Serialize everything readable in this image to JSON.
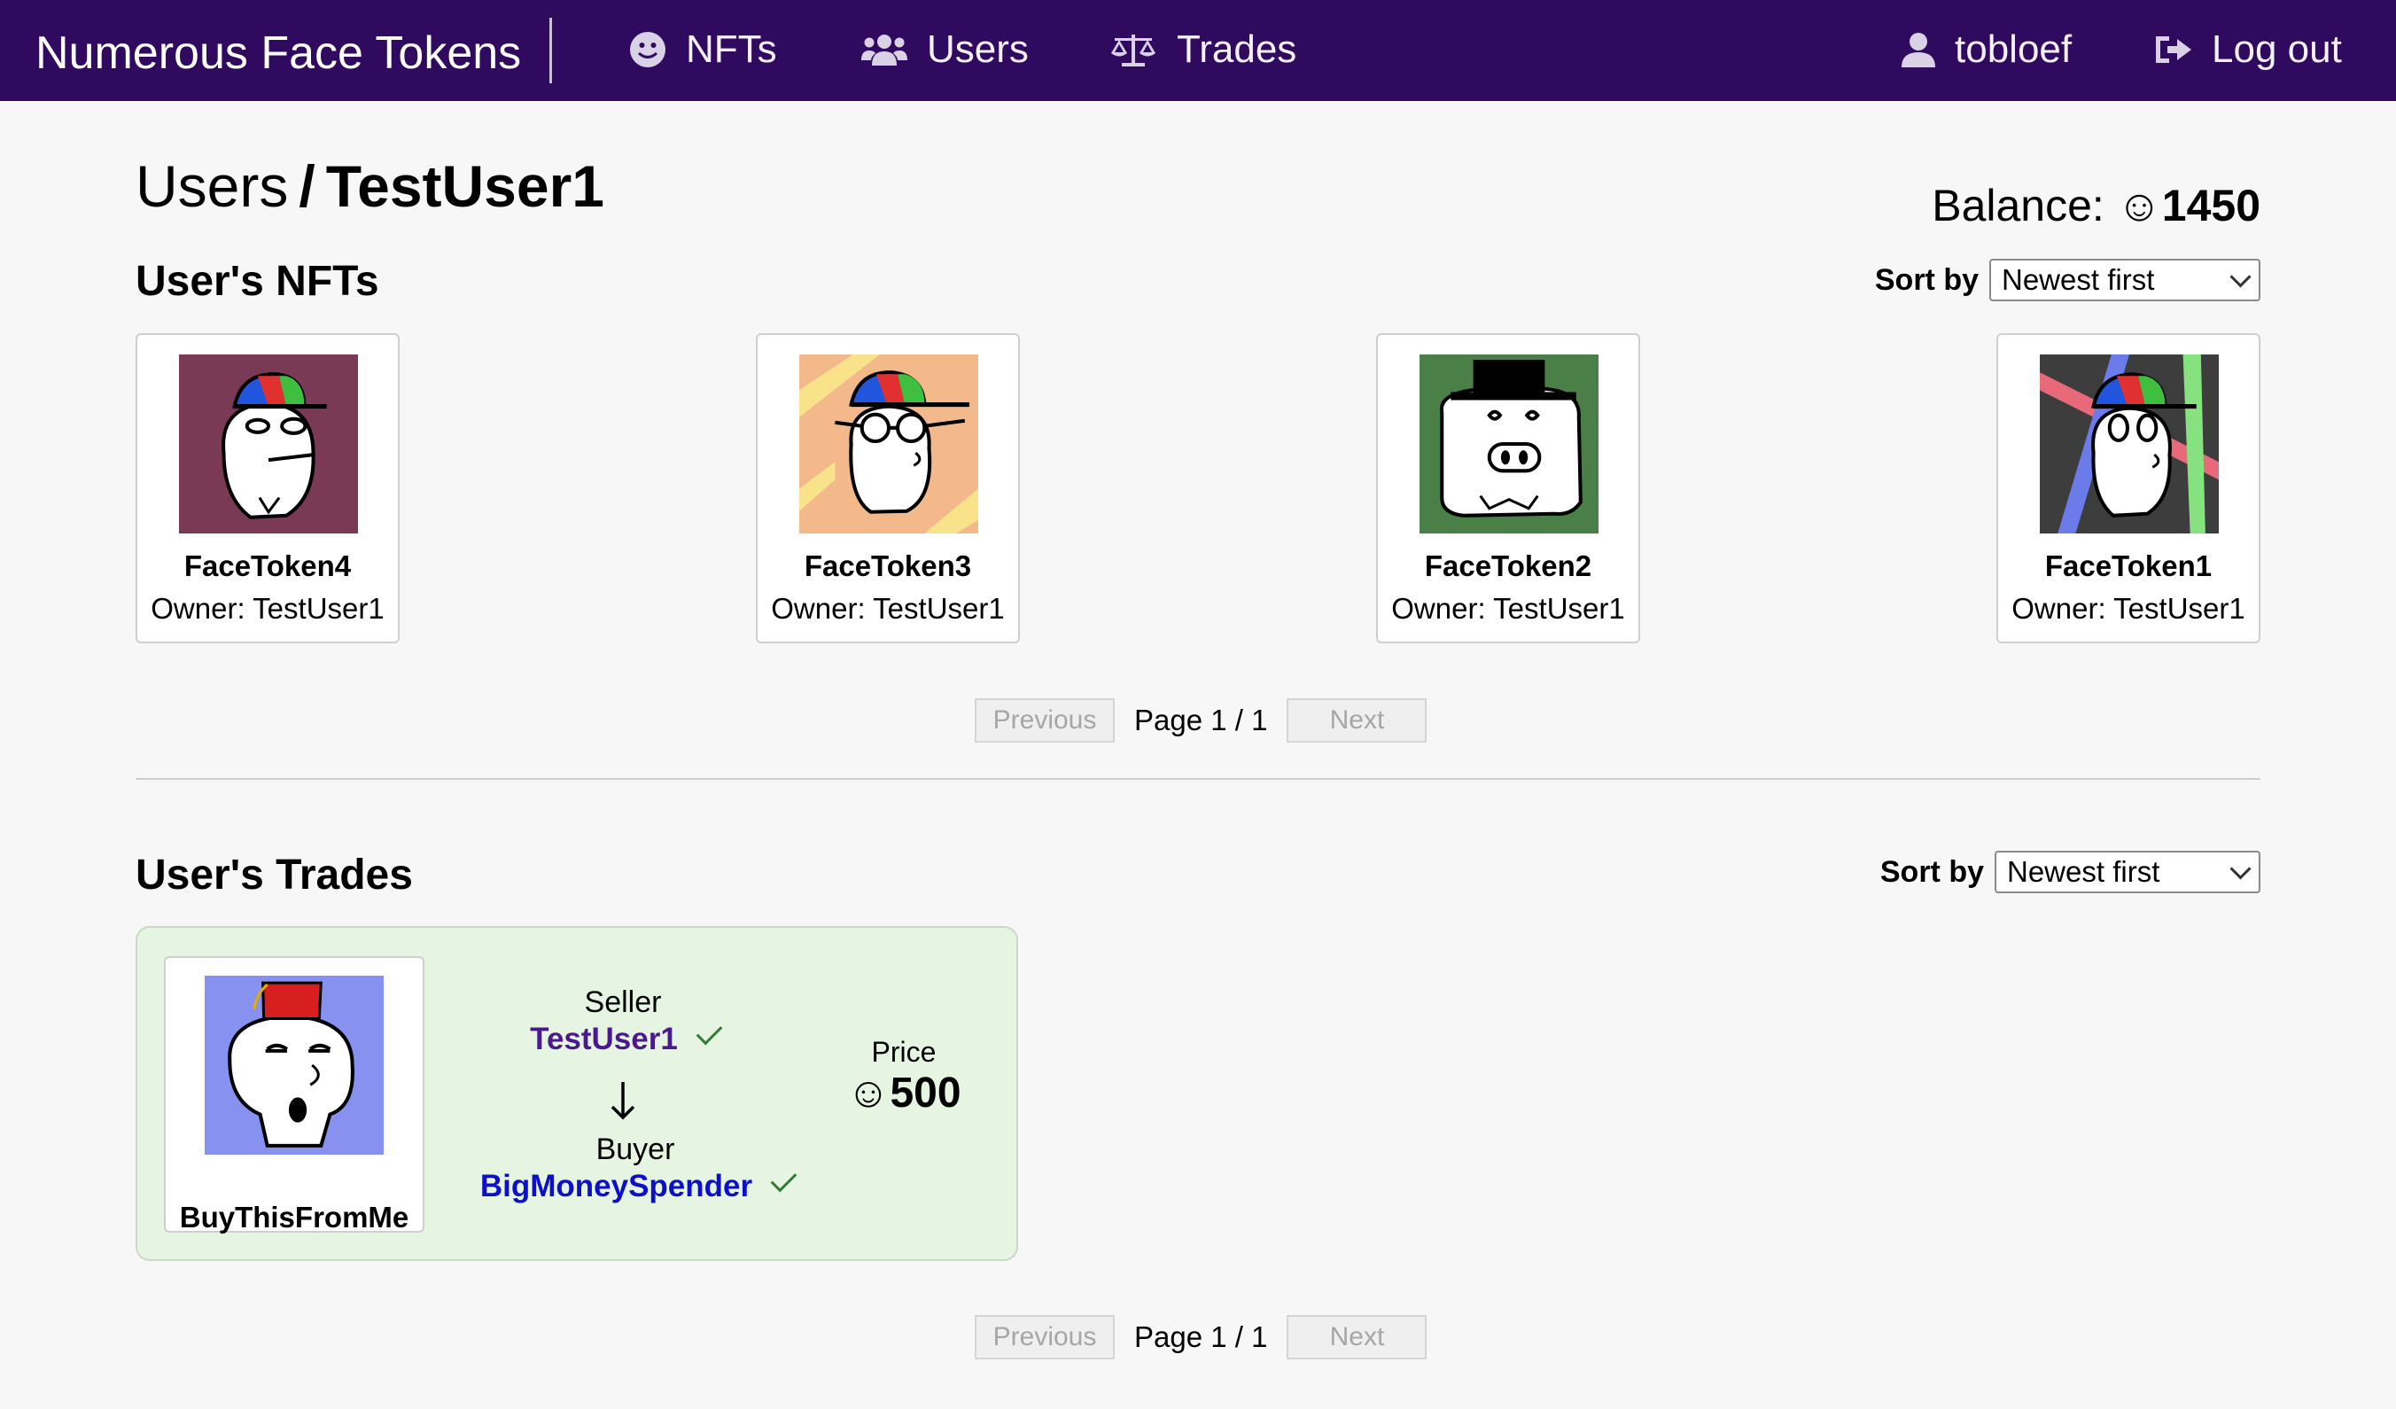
{
  "nav": {
    "brand": "Numerous Face Tokens",
    "items": [
      {
        "label": "NFTs",
        "icon": "smiley-icon"
      },
      {
        "label": "Users",
        "icon": "users-icon"
      },
      {
        "label": "Trades",
        "icon": "scale-icon"
      }
    ],
    "user": {
      "label": "tobloef",
      "icon": "user-icon"
    },
    "logout": {
      "label": "Log out",
      "icon": "logout-icon"
    }
  },
  "page": {
    "breadcrumb_parent": "Users",
    "breadcrumb_sep": "/",
    "breadcrumb_current": "TestUser1",
    "balance_label": "Balance:",
    "balance_value": "☺1450"
  },
  "nfts_section": {
    "title": "User's NFTs",
    "sort_label": "Sort by",
    "sort_value": "Newest first",
    "cards": [
      {
        "name": "FaceToken4",
        "owner": "Owner: TestUser1",
        "bg": "#7a3a55"
      },
      {
        "name": "FaceToken3",
        "owner": "Owner: TestUser1",
        "bg": "#f3b98a"
      },
      {
        "name": "FaceToken2",
        "owner": "Owner: TestUser1",
        "bg": "#4b7f48"
      },
      {
        "name": "FaceToken1",
        "owner": "Owner: TestUser1",
        "bg": "#3d3d3d"
      }
    ],
    "pagination": {
      "prev": "Previous",
      "page": "Page 1 / 1",
      "next": "Next"
    }
  },
  "trades_section": {
    "title": "User's Trades",
    "sort_label": "Sort by",
    "sort_value": "Newest first",
    "trade": {
      "nft_name": "BuyThisFromMe",
      "nft_bg": "#8791f0",
      "seller_label": "Seller",
      "seller_name": "TestUser1",
      "seller_color": "#4a1a8c",
      "buyer_label": "Buyer",
      "buyer_name": "BigMoneySpender",
      "buyer_color": "#0d10c9",
      "price_label": "Price",
      "price_value": "☺500"
    },
    "pagination": {
      "prev": "Previous",
      "page": "Page 1 / 1",
      "next": "Next"
    }
  }
}
